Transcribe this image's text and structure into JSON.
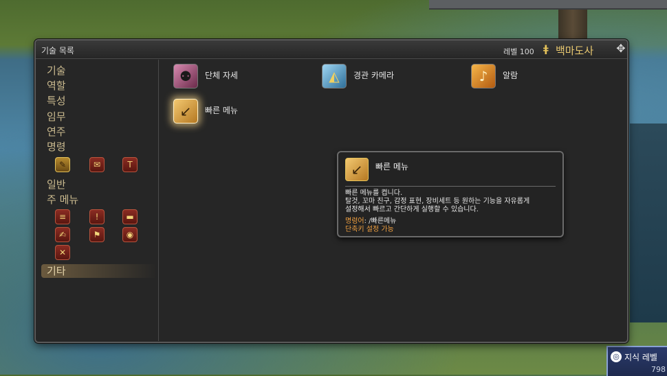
{
  "window": {
    "title": "기술 목록",
    "level_label": "레벨 100",
    "job_name": "백마도사"
  },
  "sidebar": {
    "items": [
      {
        "label": "기술"
      },
      {
        "label": "역할"
      },
      {
        "label": "특성"
      },
      {
        "label": "임무"
      },
      {
        "label": "연주"
      },
      {
        "label": "명령"
      },
      {
        "label": "일반"
      },
      {
        "label": "주 메뉴"
      },
      {
        "label": "기타"
      }
    ],
    "command_icons": [
      "pose-icon",
      "map-icon",
      "flag-icon"
    ],
    "menu_icons": [
      "list-icon",
      "alert-icon",
      "book-icon",
      "scroll-icon",
      "flag-list-icon",
      "coins-icon",
      "x-v-icon"
    ]
  },
  "actions": [
    {
      "label": "단체 자세",
      "icon": "group-pose-icon"
    },
    {
      "label": "경관 카메라",
      "icon": "camera-icon"
    },
    {
      "label": "알람",
      "icon": "alarm-bell-icon"
    },
    {
      "label": "빠른 메뉴",
      "icon": "quick-menu-icon"
    }
  ],
  "tooltip": {
    "title": "빠른 메뉴",
    "desc_line1": "빠른 메뉴를 켭니다.",
    "desc_line2": "탈것, 꼬마 친구, 감정 표현, 장비세트 등 원하는 기능을 자유롭게",
    "desc_line3": "설정해서 빠르고 간단하게 실행할 수 있습니다.",
    "command_key": "명령어",
    "command_value": ": /빠른메뉴",
    "shortcut": "단축키 설정 가능"
  },
  "hud": {
    "knowledge_label": "지식 레벨",
    "knowledge_value": "798"
  }
}
